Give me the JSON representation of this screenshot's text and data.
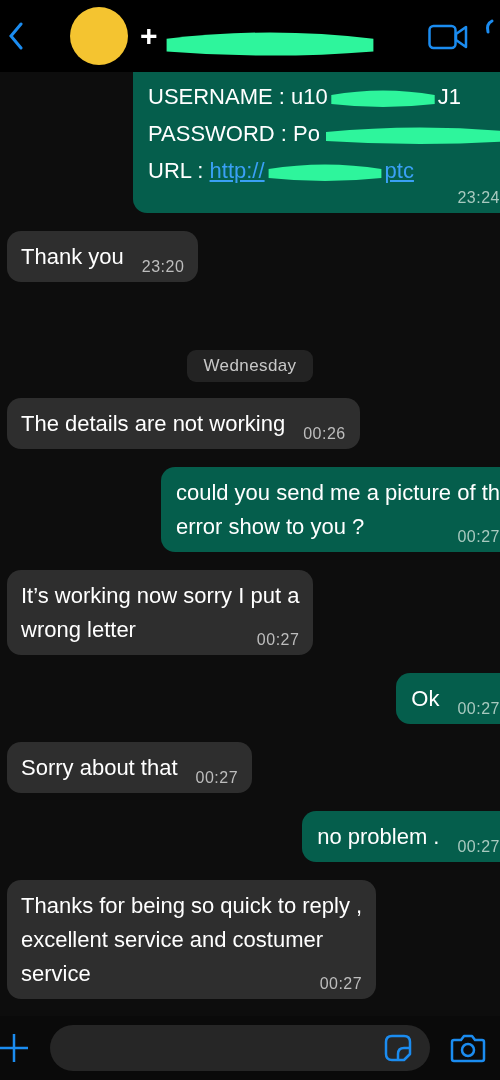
{
  "header": {
    "contact_name": "+",
    "redacted": true
  },
  "messages": [
    {
      "kind": "credentials",
      "rows": [
        {
          "text": "USERNAME : u10",
          "tail": "J1",
          "redacted": true
        },
        {
          "text": "PASSWORD : Po",
          "redacted": true
        },
        {
          "text": "URL : ",
          "link": "http://",
          "link_tail": "ptc",
          "redacted": true
        }
      ],
      "time": "23:24"
    },
    {
      "kind": "in",
      "lines": [
        "Thank you"
      ],
      "time": "23:20"
    },
    {
      "kind": "day",
      "text": "Wednesday"
    },
    {
      "kind": "in",
      "lines": [
        "The details are not working"
      ],
      "time": "00:26"
    },
    {
      "kind": "out",
      "lines": [
        "could you send me a picture of th",
        "error show to you ?"
      ],
      "time": "00:27"
    },
    {
      "kind": "in",
      "lines": [
        "It’s working now sorry I put a",
        "wrong letter"
      ],
      "time": "00:27"
    },
    {
      "kind": "out",
      "lines": [
        "Ok"
      ],
      "time": "00:27"
    },
    {
      "kind": "in",
      "lines": [
        "Sorry about that"
      ],
      "time": "00:27"
    },
    {
      "kind": "out",
      "lines": [
        "no problem ."
      ],
      "time": "00:27"
    },
    {
      "kind": "in",
      "lines": [
        "Thanks for being so quick to reply ,",
        "excellent service and costumer",
        "service"
      ],
      "time": "00:27"
    }
  ]
}
